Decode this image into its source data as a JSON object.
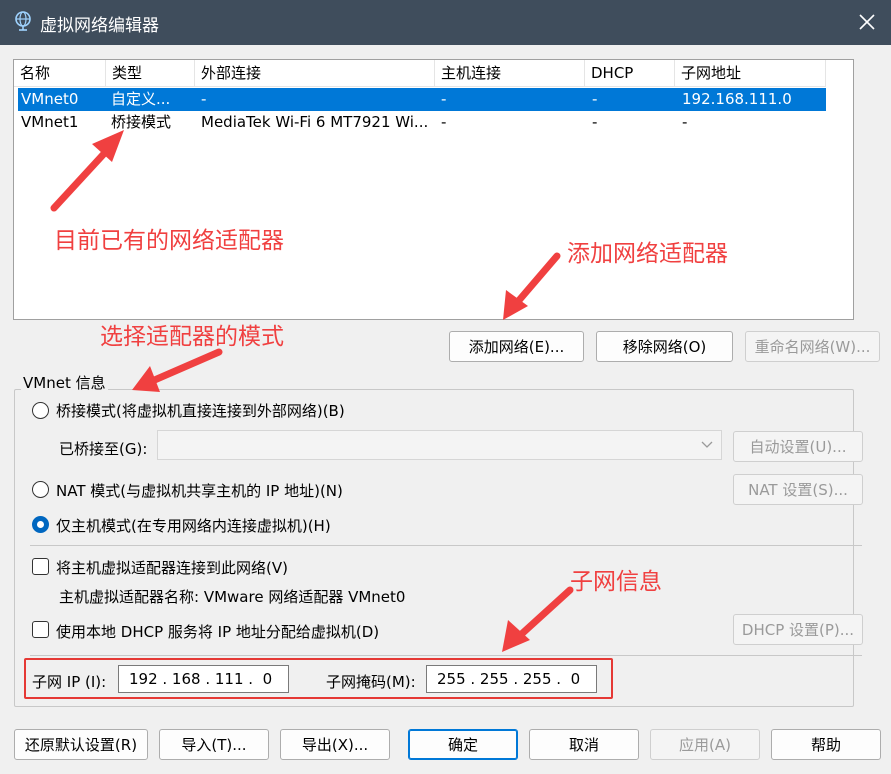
{
  "window": {
    "title": "虚拟网络编辑器",
    "icon": "network-globe-icon",
    "close_icon": "close-icon"
  },
  "network_table": {
    "columns": [
      "名称",
      "类型",
      "外部连接",
      "主机连接",
      "DHCP",
      "子网地址"
    ],
    "rows": [
      {
        "name": "VMnet0",
        "type": "自定义...",
        "external": "-",
        "host": "-",
        "dhcp": "-",
        "subnet": "192.168.111.0",
        "selected": true
      },
      {
        "name": "VMnet1",
        "type": "桥接模式",
        "external": "MediaTek Wi-Fi 6 MT7921 Wi...",
        "host": "-",
        "dhcp": "-",
        "subnet": "-",
        "selected": false
      }
    ]
  },
  "list_buttons": {
    "add": "添加网络(E)...",
    "remove": "移除网络(O)",
    "rename": "重命名网络(W)..."
  },
  "vmnet_info": {
    "group_label": "VMnet 信息",
    "bridged_mode": "桥接模式(将虚拟机直接连接到外部网络)(B)",
    "bridged_to_label": "已桥接至(G):",
    "bridged_to_value": "",
    "auto_settings": "自动设置(U)...",
    "nat_mode": "NAT 模式(与虚拟机共享主机的 IP 地址)(N)",
    "nat_settings": "NAT 设置(S)...",
    "host_only_mode": "仅主机模式(在专用网络内连接虚拟机)(H)",
    "selected_mode": "host_only",
    "connect_host_adapter": "将主机虚拟适配器连接到此网络(V)",
    "connect_host_adapter_checked": false,
    "host_adapter_name": "主机虚拟适配器名称: VMware 网络适配器 VMnet0",
    "use_dhcp": "使用本地 DHCP 服务将 IP 地址分配给虚拟机(D)",
    "use_dhcp_checked": false,
    "dhcp_settings": "DHCP 设置(P)...",
    "subnet_ip_label": "子网 IP (I):",
    "subnet_ip": "192 . 168 . 111 .  0",
    "subnet_mask_label": "子网掩码(M):",
    "subnet_mask": "255 . 255 . 255 .  0"
  },
  "bottom_buttons": {
    "restore_defaults": "还原默认设置(R)",
    "import": "导入(T)...",
    "export": "导出(X)...",
    "ok": "确定",
    "cancel": "取消",
    "apply": "应用(A)",
    "help": "帮助"
  },
  "annotations": {
    "existing_adapters": "目前已有的网络适配器",
    "add_adapter": "添加网络适配器",
    "select_mode": "选择适配器的模式",
    "subnet_info": "子网信息",
    "color": "#f04040"
  },
  "colors": {
    "titlebar": "#3f4d5c",
    "selection": "#0078d7",
    "accent": "#0067c0"
  }
}
